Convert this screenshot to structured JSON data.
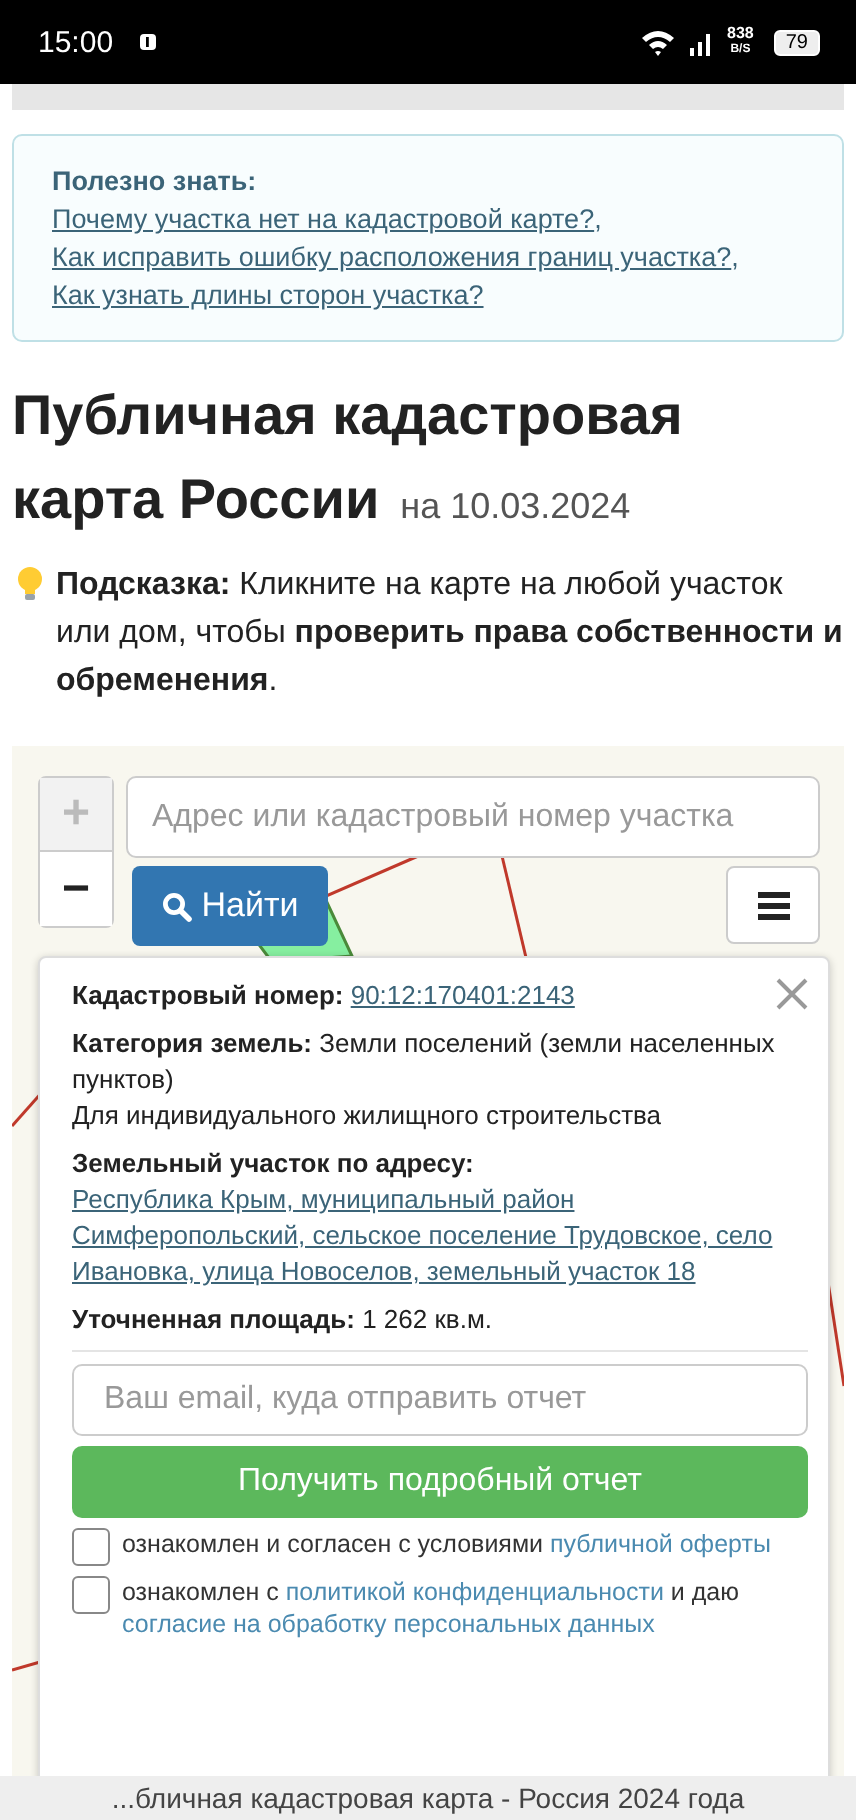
{
  "status_bar": {
    "time": "15:00",
    "network_speed": "838",
    "speed_unit": "B/S",
    "battery": "79"
  },
  "info_box": {
    "segments": [
      {
        "kind": "bold",
        "text": "Полезно знать: "
      },
      {
        "kind": "link",
        "text": "Почему участка нет на кадастровой карте?"
      },
      {
        "kind": "plain",
        "text": ", "
      },
      {
        "kind": "link",
        "text": "Как исправить ошибку расположения границ участка?"
      },
      {
        "kind": "plain",
        "text": ", "
      },
      {
        "kind": "link",
        "text": "Как узнать длины сторон участка?"
      }
    ]
  },
  "heading": {
    "title": "Публичная кадастровая карта России",
    "date": "на 10.03.2024"
  },
  "hint": {
    "segments": [
      {
        "kind": "bold",
        "text": "Подсказка:"
      },
      {
        "kind": "plain",
        "text": " Кликните на карте на любой участок или дом, чтобы "
      },
      {
        "kind": "bold",
        "text": "проверить права собственности и обременения"
      },
      {
        "kind": "plain",
        "text": "."
      }
    ]
  },
  "map": {
    "zoom_in": {
      "label": "+",
      "disabled": true
    },
    "zoom_out": {
      "label": "−",
      "disabled": false
    },
    "search": {
      "placeholder": "Адрес или кадастровый номер участка"
    },
    "search_button": "Найти"
  },
  "popup": {
    "cadastral": {
      "label": "Кадастровый номер: ",
      "value": "90:12:170401:2143"
    },
    "category": {
      "label": "Категория земель: ",
      "value": "Земли поселений (земли населенных пунктов)",
      "usage": "Для индивидуального жилищного строительства"
    },
    "address": {
      "label": "Земельный участок по адресу: ",
      "value": "Республика Крым, муниципальный район Симферопольский, сельское поселение Трудовское, село Ивановка, улица Новоселов, земельный участок 18"
    },
    "area": {
      "label": "Уточненная площадь: ",
      "value": "1 262 кв.м."
    },
    "email": {
      "placeholder": "Ваш email, куда отправить отчет"
    },
    "report_button": "Получить подробный отчет",
    "agreements": [
      {
        "checked": false,
        "segments": [
          {
            "kind": "plain",
            "text": "ознакомлен и согласен с условиями "
          },
          {
            "kind": "link",
            "text": "публичной оферты"
          }
        ]
      },
      {
        "checked": false,
        "segments": [
          {
            "kind": "plain",
            "text": "ознакомлен с "
          },
          {
            "kind": "link",
            "text": "политикой конфиденциальности"
          },
          {
            "kind": "plain",
            "text": " и даю "
          },
          {
            "kind": "link",
            "text": "согласие на обработку персональных данных"
          }
        ]
      }
    ]
  },
  "footer": {
    "text": "...бличная кадастровая карта - Россия 2024 года"
  }
}
